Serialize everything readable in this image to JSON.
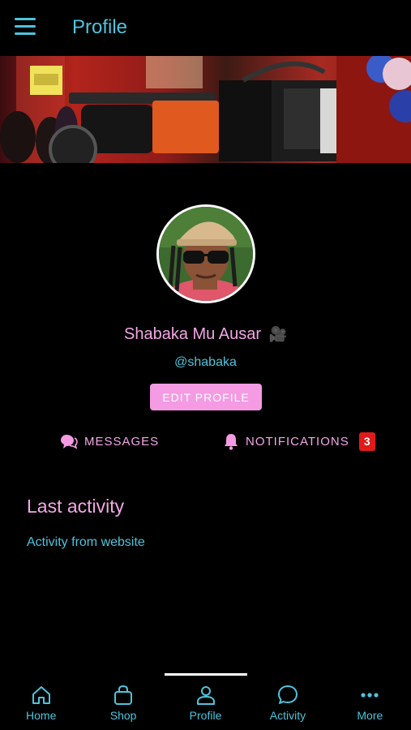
{
  "header": {
    "title": "Profile",
    "menu_icon": "hamburger-menu-icon"
  },
  "profile": {
    "name": "Shabaka Mu Ausar",
    "name_emoji": "🎥",
    "handle": "@shabaka",
    "edit_label": "EDIT PROFILE"
  },
  "links": {
    "messages_label": "MESSAGES",
    "notifications_label": "NOTIFICATIONS",
    "notifications_count": "3"
  },
  "activity": {
    "section_title": "Last activity",
    "item": "Activity from website"
  },
  "bottom_nav": [
    {
      "label": "Home",
      "icon": "home-icon"
    },
    {
      "label": "Shop",
      "icon": "shopping-bag-icon"
    },
    {
      "label": "Profile",
      "icon": "user-icon",
      "active": true
    },
    {
      "label": "Activity",
      "icon": "chat-bubble-icon"
    },
    {
      "label": "More",
      "icon": "more-dots-icon"
    }
  ],
  "colors": {
    "accent_cyan": "#4fc3dc",
    "accent_pink": "#f4a6e6",
    "button_pink": "#f49be3",
    "badge_red": "#e01a1a",
    "background": "#000000"
  }
}
